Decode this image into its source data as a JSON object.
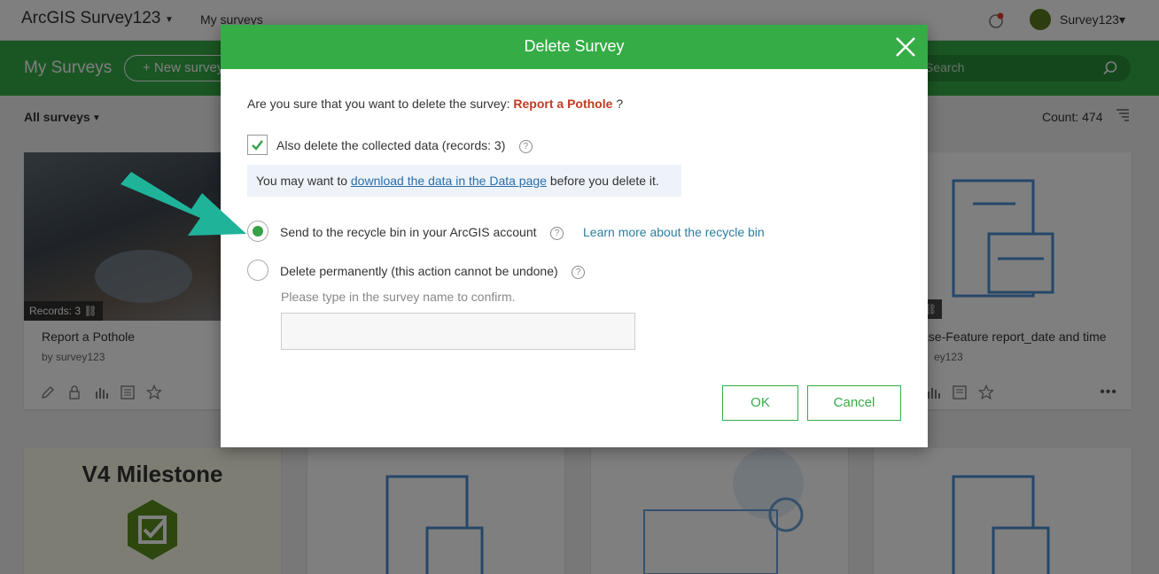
{
  "app": {
    "title": "ArcGIS Survey123",
    "nav_link": "My surveys",
    "user_name": "Survey123"
  },
  "toolbar": {
    "heading": "My Surveys",
    "new_survey": "+ New survey",
    "search_placeholder": "Search"
  },
  "filter": {
    "label": "All surveys",
    "count": "Count: 474"
  },
  "cards": [
    {
      "records": "Records: 3",
      "title": "Report a Pothole",
      "owner": "by survey123"
    },
    {
      "title": "ase-Feature report_date and time",
      "owner": "ey123"
    },
    {
      "title": "V4 Milestone"
    }
  ],
  "modal": {
    "title": "Delete Survey",
    "question_prefix": "Are you sure that you want to delete the survey:",
    "survey_name": "Report a Pothole",
    "question_suffix": "?",
    "also_delete_label": "Also delete the collected data (records: 3)",
    "hint_prefix": "You may want to",
    "hint_link": "download the data in the Data page",
    "hint_suffix": "before you delete it.",
    "option_recycle": "Send to the recycle bin in your ArcGIS account",
    "recycle_link": "Learn more about the recycle bin",
    "option_permanent": "Delete permanently (this action cannot be undone)",
    "confirm_hint": "Please type in the survey name to confirm.",
    "ok_label": "OK",
    "cancel_label": "Cancel",
    "also_delete_checked": true,
    "selected_option": "recycle"
  },
  "colors": {
    "brand_green": "#35ac46",
    "survey_name": "#c23b22",
    "annotation_arrow": "#1fb39a"
  }
}
